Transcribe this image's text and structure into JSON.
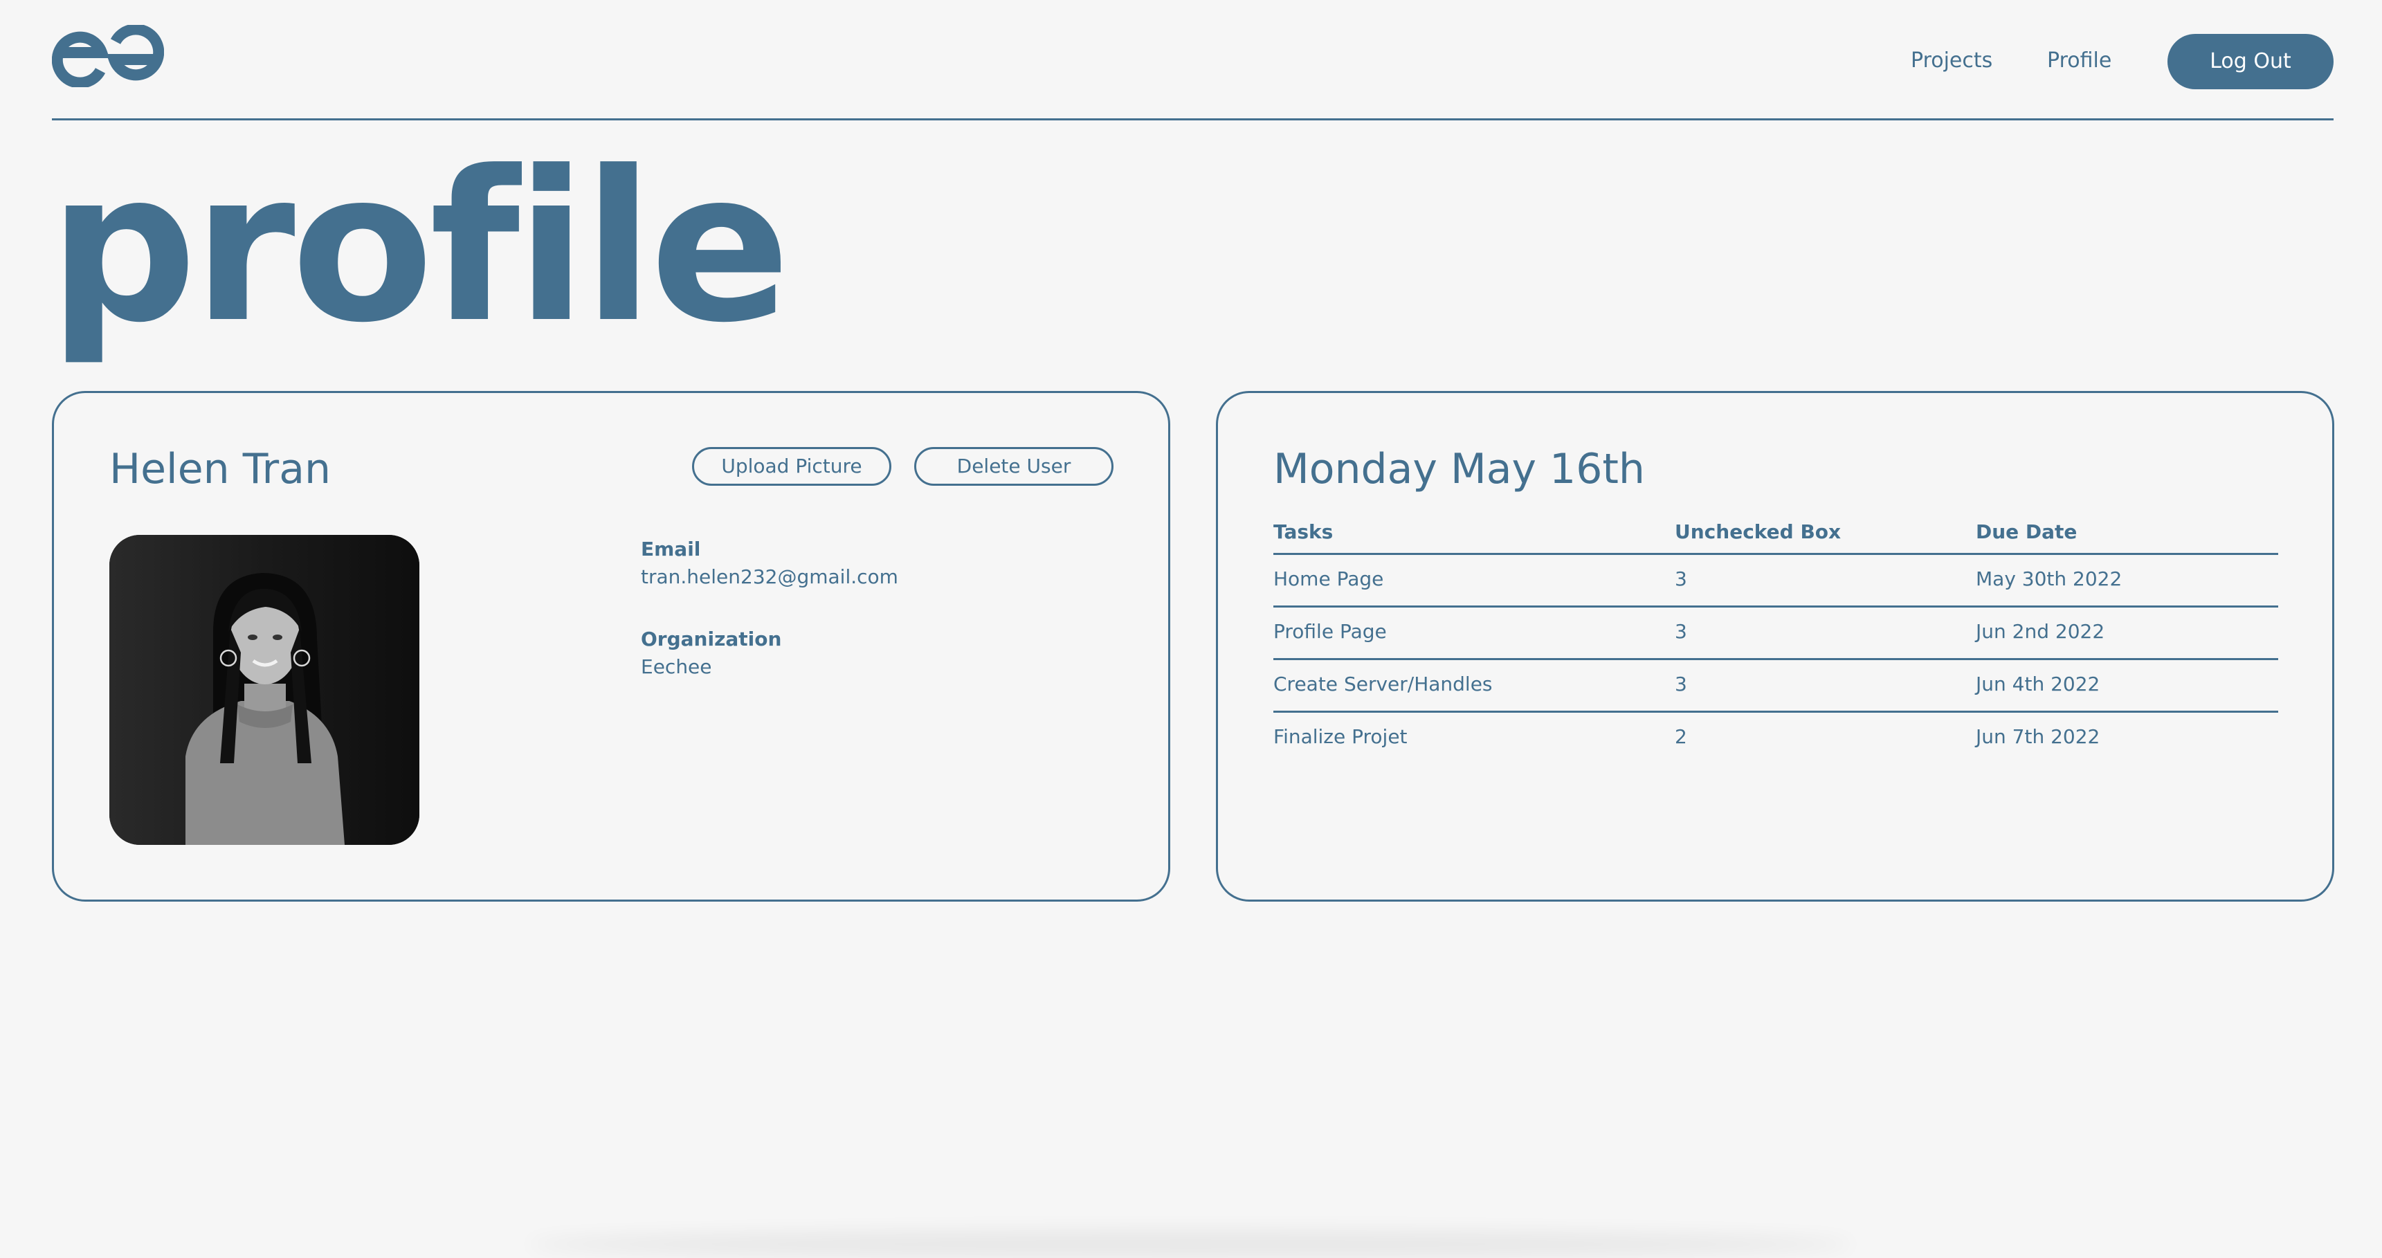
{
  "header": {
    "logo_alt": "ee",
    "nav": [
      {
        "label": "Projects"
      },
      {
        "label": "Profile"
      }
    ],
    "logout_label": "Log Out"
  },
  "page": {
    "title": "profile"
  },
  "profile_card": {
    "name": "Helen Tran",
    "upload_label": "Upload Picture",
    "delete_label": "Delete User",
    "email_label": "Email",
    "email_value": "tran.helen232@gmail.com",
    "org_label": "Organization",
    "org_value": "Eechee"
  },
  "tasks_card": {
    "date": "Monday May 16th",
    "columns": [
      "Tasks",
      "Unchecked Box",
      "Due Date"
    ],
    "rows": [
      {
        "task": "Home Page",
        "unchecked": "3",
        "due": "May 30th 2022"
      },
      {
        "task": "Profile Page",
        "unchecked": "3",
        "due": "Jun 2nd 2022"
      },
      {
        "task": "Create Server/Handles",
        "unchecked": "3",
        "due": "Jun 4th 2022"
      },
      {
        "task": "Finalize Projet",
        "unchecked": "2",
        "due": "Jun 7th 2022"
      }
    ]
  },
  "colors": {
    "accent": "#44708f",
    "background": "#f6f6f6"
  }
}
